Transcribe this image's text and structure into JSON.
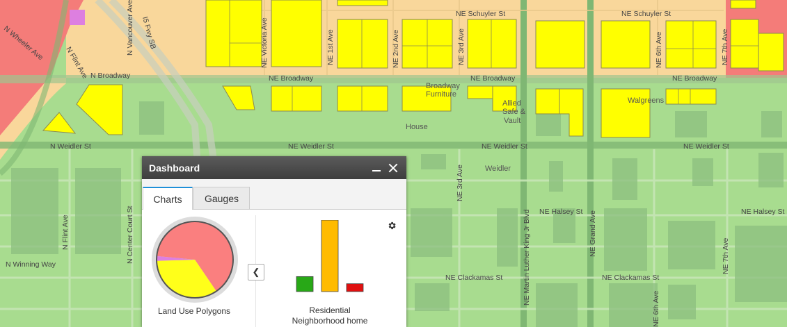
{
  "map": {
    "streets": {
      "schuyler_1": "NE Schuyler St",
      "schuyler_2": "NE Schuyler St",
      "broadway_w": "N Broadway",
      "broadway_e1": "NE Broadway",
      "broadway_e2": "NE Broadway",
      "broadway_e3": "NE Broadway",
      "weidler_w": "N Weidler St",
      "weidler_e1": "NE Weidler St",
      "weidler_e2": "NE Weidler St",
      "weidler_e3": "NE Weidler St",
      "halsey_1": "NE Halsey St",
      "halsey_2": "NE Halsey St",
      "clackamas_1": "NE Clackamas St",
      "clackamas_2": "NE Clackamas St",
      "winning_way": "N Winning Way",
      "wheeler": "N Wheeler Ave",
      "flint_n": "N Flint Ave",
      "flint_s": "N Flint Ave",
      "vancouver": "N Vancouver Ave",
      "victoria": "NE Victoria Ave",
      "first": "NE 1st Ave",
      "second": "NE 2nd Ave",
      "third_n": "NE 3rd Ave",
      "third_s": "NE 3rd Ave",
      "mlk": "NE Martin Luther King Jr Blvd",
      "grand": "NE Grand Ave",
      "sixth_n": "NE 6th Ave",
      "sixth_s": "NE 6th Ave",
      "seventh_n": "NE 7th Ave",
      "seventh_s": "NE 7th Ave",
      "center_court": "N Center Court St",
      "freeway": "I5 Fwy SB"
    },
    "pois": {
      "broadway_furniture_1": "Broadway",
      "broadway_furniture_2": "Furniture",
      "safe_1": "Allied",
      "safe_2": "Safe &",
      "safe_3": "Vault",
      "house": "House",
      "weidler": "Weidler",
      "walgreens": "Walgreens"
    },
    "colors": {
      "residential": "#a8dc8f",
      "commercial": "#ffff00",
      "mixed": "#f9d79b",
      "industrial": "#f47c79",
      "public": "#dd7fe0"
    }
  },
  "dashboard": {
    "title": "Dashboard",
    "minimize_icon": "minimize-icon",
    "close_icon": "close-icon",
    "tabs": [
      {
        "label": "Charts",
        "active": true
      },
      {
        "label": "Gauges",
        "active": false
      }
    ],
    "pie_label": "Land Use Polygons",
    "bar_label_line1": "Residential",
    "bar_label_line2": "Neighborhood home",
    "prev_icon": "chevron-left-icon",
    "settings_icon": "gear-icon"
  },
  "chart_data": [
    {
      "type": "pie",
      "title": "Land Use Polygons",
      "slices": [
        {
          "value": 0.64,
          "color": "#fa7f7f"
        },
        {
          "value": 0.34,
          "color": "#ffff1a"
        },
        {
          "value": 0.02,
          "color": "#dd7fe0"
        }
      ]
    },
    {
      "type": "bar",
      "title": "Residential Neighborhood home",
      "categories": [
        "",
        "",
        ""
      ],
      "values": [
        21,
        100,
        11
      ],
      "colors": [
        "#28a817",
        "#ffbb00",
        "#e01010"
      ],
      "ylim": [
        0,
        100
      ]
    }
  ]
}
